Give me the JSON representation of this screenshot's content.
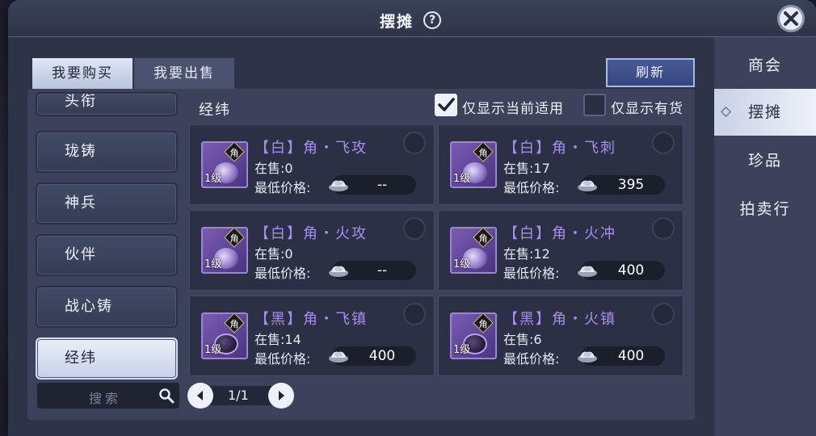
{
  "title": "摆摊",
  "help_label": "?",
  "tabs": {
    "buy": "我要购买",
    "sell": "我要出售"
  },
  "refresh_label": "刷新",
  "sidenav": [
    "商会",
    "摆摊",
    "珍品",
    "拍卖行"
  ],
  "sidenav_active": "摆摊",
  "categories": {
    "partial": "头衔",
    "items": [
      "珑铸",
      "神兵",
      "伙伴",
      "战心铸",
      "经纬"
    ]
  },
  "active_category": "经纬",
  "section_title": "经纬",
  "filters": {
    "current_applicable": {
      "label": "仅显示当前适用",
      "checked": true
    },
    "in_stock": {
      "label": "仅显示有货",
      "checked": false
    }
  },
  "search": {
    "placeholder": "搜索"
  },
  "pager": {
    "text": "1/1"
  },
  "items": [
    {
      "name": "【白】角・飞攻",
      "stock": "在售:0",
      "price_label": "最低价格:",
      "price": "--",
      "level": "1级",
      "badge": "角",
      "variant": "light"
    },
    {
      "name": "【白】角・飞刺",
      "stock": "在售:17",
      "price_label": "最低价格:",
      "price": "395",
      "level": "1级",
      "badge": "角",
      "variant": "light"
    },
    {
      "name": "【白】角・火攻",
      "stock": "在售:0",
      "price_label": "最低价格:",
      "price": "--",
      "level": "1级",
      "badge": "角",
      "variant": "light"
    },
    {
      "name": "【白】角・火冲",
      "stock": "在售:12",
      "price_label": "最低价格:",
      "price": "400",
      "level": "1级",
      "badge": "角",
      "variant": "light"
    },
    {
      "name": "【黑】角・飞镇",
      "stock": "在售:14",
      "price_label": "最低价格:",
      "price": "400",
      "level": "1级",
      "badge": "角",
      "variant": "dark"
    },
    {
      "name": "【黑】角・火镇",
      "stock": "在售:6",
      "price_label": "最低价格:",
      "price": "400",
      "level": "1级",
      "badge": "角",
      "variant": "dark"
    }
  ],
  "colors": {
    "item_name": "#a88cf0",
    "panel": "#3b4259",
    "accent": "#4a5a96"
  }
}
